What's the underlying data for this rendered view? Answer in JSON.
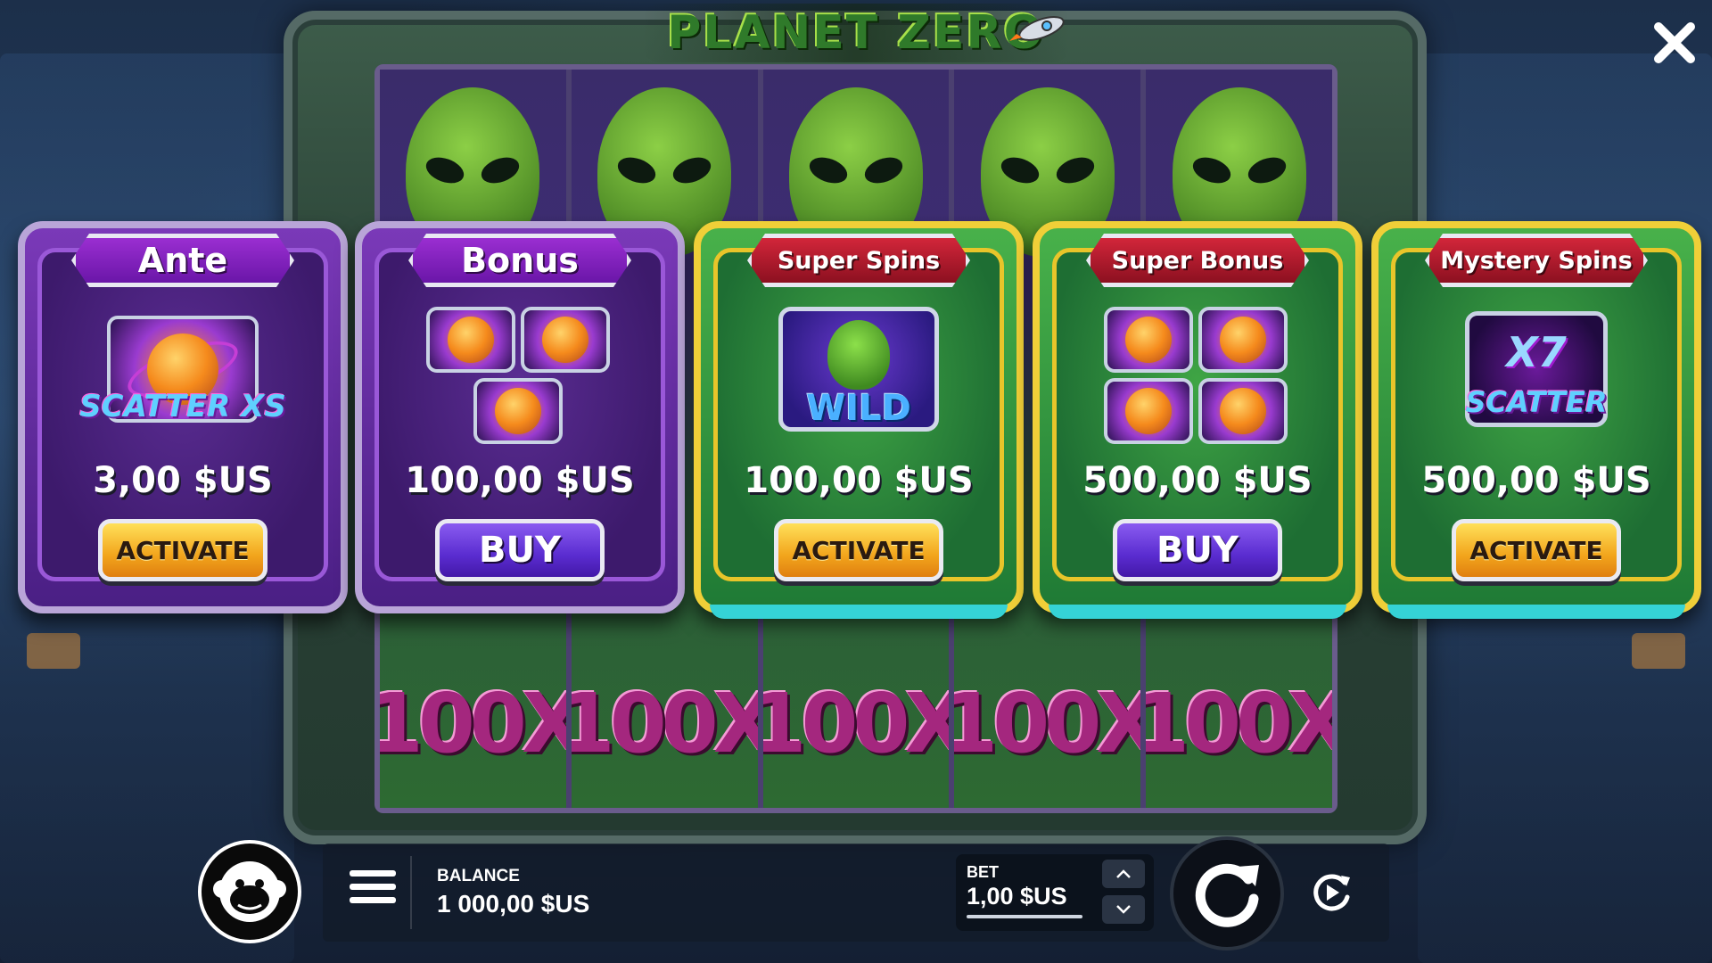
{
  "game": {
    "logo_text": "PLANET ZERO",
    "reel_multiplier": "100X",
    "reel_count": 5
  },
  "cards": [
    {
      "title": "Ante",
      "price": "3,00 $US",
      "action": "ACTIVATE",
      "theme": "purple",
      "art": "scatter-xs-symbol",
      "art_text": "SCATTER XS"
    },
    {
      "title": "Bonus",
      "price": "100,00 $US",
      "action": "BUY",
      "theme": "purple",
      "art": "three-scatter-symbols"
    },
    {
      "title": "Super Spins",
      "price": "100,00 $US",
      "action": "ACTIVATE",
      "theme": "green",
      "art": "wild-symbol",
      "art_text": "WILD"
    },
    {
      "title": "Super Bonus",
      "price": "500,00 $US",
      "action": "BUY",
      "theme": "green",
      "art": "four-scatter-symbols"
    },
    {
      "title": "Mystery Spins",
      "price": "500,00 $US",
      "action": "ACTIVATE",
      "theme": "green",
      "art": "x7-scatter-symbol",
      "art_text_top": "X7",
      "art_text_bottom": "SCATTER"
    }
  ],
  "bottom_bar": {
    "balance_label": "BALANCE",
    "balance_value": "1 000,00 $US",
    "bet_label": "BET",
    "bet_value": "1,00 $US"
  },
  "icons": {
    "close": "close-icon",
    "menu": "hamburger-menu-icon",
    "spin": "spin-refresh-icon",
    "autoplay": "autoplay-icon",
    "brand": "monkey-logo-icon"
  },
  "colors": {
    "activate_button": "#f2a51c",
    "buy_button": "#5a2cd0",
    "purple_banner": "#6a16a8",
    "green_banner": "#8c1020"
  }
}
